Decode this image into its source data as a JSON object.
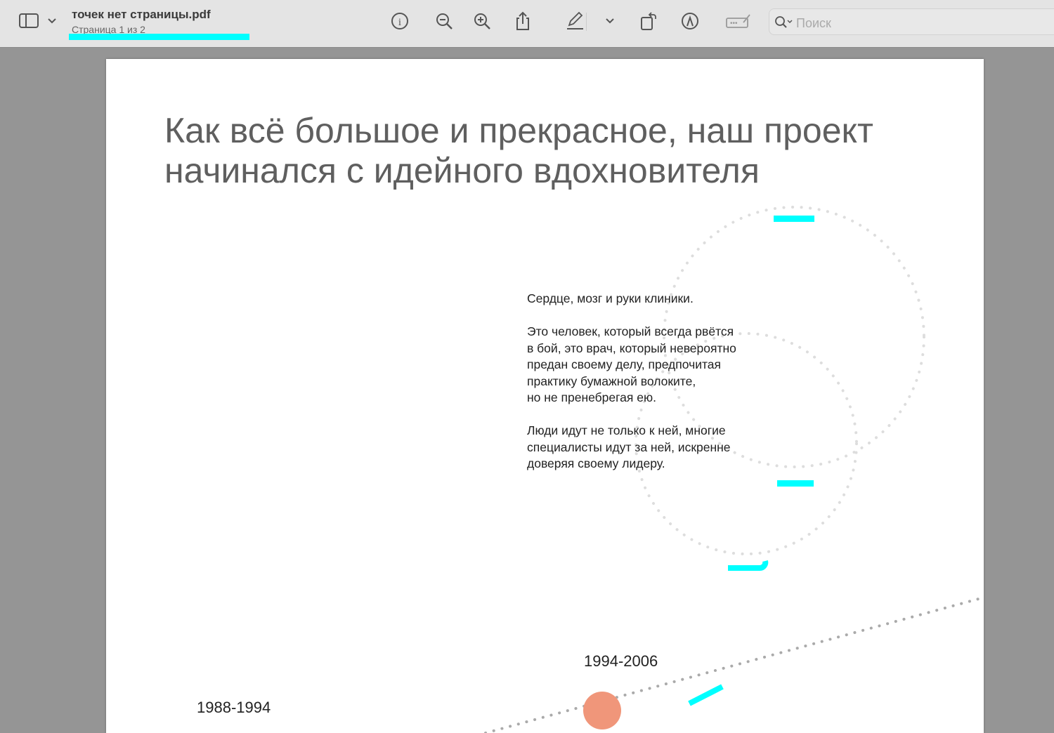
{
  "window": {
    "title": "точек нет страницы.pdf",
    "subtitle": "Страница 1 из 2"
  },
  "toolbar": {
    "search_placeholder": "Поиск"
  },
  "page": {
    "heading": "Как всё большое и прекрасное, наш проект начинался с идейного вдохновителя",
    "paragraphs": [
      "Сердце, мозг и руки клиники.",
      "Это человек, который всегда рвётся\nв бой, это врач, который невероятно\nпредан своему делу, предпочитая\nпрактику бумажной волоките,\nно не пренебрегая ею.",
      "Люди идут не только к ней, многие\nспециалисты идут за ней, искренне\nдоверяя своему лидеру."
    ],
    "years": [
      "1994-2006",
      "1988-1994"
    ]
  },
  "colors": {
    "accent": "#00ffff",
    "dot": "#f0967a"
  }
}
